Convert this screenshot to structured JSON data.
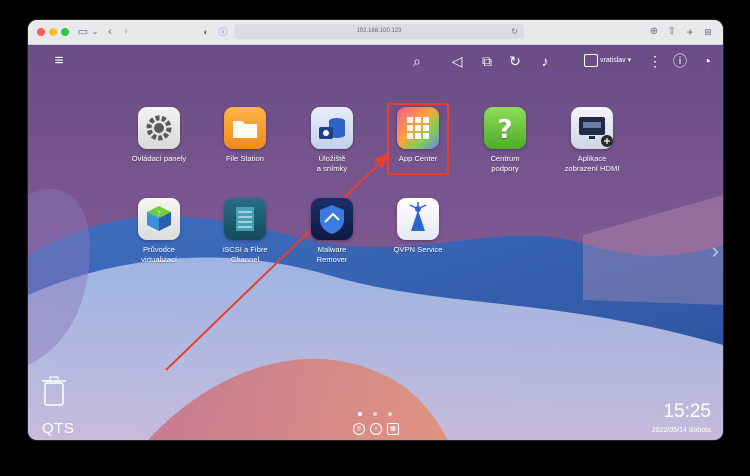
{
  "browser": {
    "url": "192.168.100.123"
  },
  "topbar": {
    "username": "vratislav ▾"
  },
  "apps": [
    {
      "label": "Ovládací panely"
    },
    {
      "label": "File Station"
    },
    {
      "label": "Úložiště\na snímky"
    },
    {
      "label": "App Center"
    },
    {
      "label": "Centrum\npodpory"
    },
    {
      "label": "Aplikace\nzobrazení HDMI"
    },
    {
      "label": "Průvodce\nvirtualizací"
    },
    {
      "label": "iSCSI a Fibre\nChannel"
    },
    {
      "label": "Malware\nRemover"
    },
    {
      "label": "QVPN Service"
    }
  ],
  "desktop": {
    "brand": "QTS",
    "time": "15:25",
    "date": "2022/05/14 Sobota"
  },
  "colors": {
    "highlight": "#e8402f",
    "arrow": "#e8402f"
  }
}
